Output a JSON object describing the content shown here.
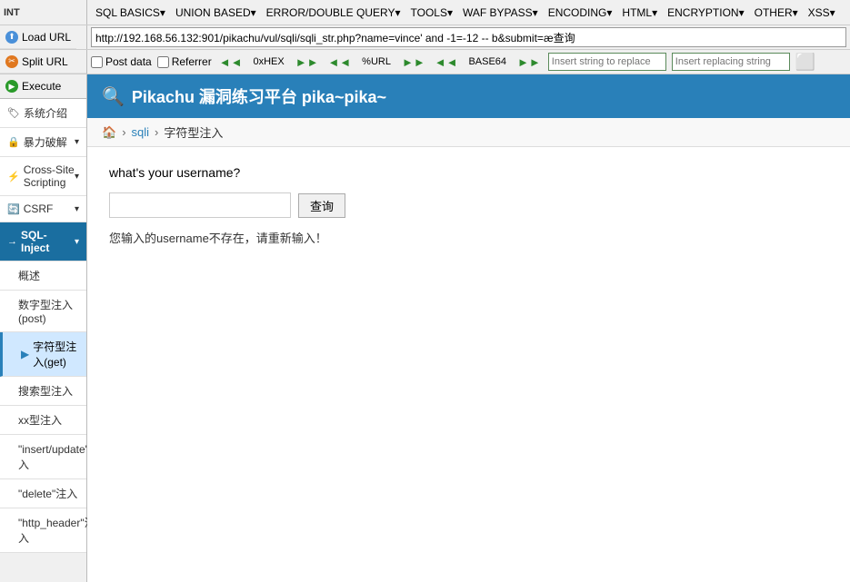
{
  "toolbar": {
    "int_label": "INT",
    "menu_items": [
      {
        "label": "SQL BASICS",
        "has_arrow": true
      },
      {
        "label": "UNION BASED",
        "has_arrow": true
      },
      {
        "label": "ERROR/DOUBLE QUERY",
        "has_arrow": true
      },
      {
        "label": "TOOLS",
        "has_arrow": true
      },
      {
        "label": "WAF BYPASS",
        "has_arrow": true
      },
      {
        "label": "ENCODING",
        "has_arrow": true
      },
      {
        "label": "HTML",
        "has_arrow": true
      },
      {
        "label": "ENCRYPTION",
        "has_arrow": true
      },
      {
        "label": "OTHER",
        "has_arrow": true
      },
      {
        "label": "XSS",
        "has_arrow": true
      }
    ],
    "load_url_label": "Load URL",
    "split_url_label": "Split URL",
    "execute_label": "Execute",
    "url_value": "http://192.168.56.132:901/pikachu/vul/sqli/sqli_str.php?name=vince' and -1=-12 -- b&submit=æ查询",
    "checkboxes": [
      {
        "label": "Post data",
        "checked": false
      },
      {
        "label": "Referrer",
        "checked": false
      }
    ],
    "encode_buttons": [
      {
        "label": "0xHEX"
      },
      {
        "label": "%URL"
      },
      {
        "label": "BASE64"
      }
    ],
    "string_to_replace_placeholder": "Insert string to replace",
    "replacing_string_placeholder": "Insert replacing string",
    "load_icon": "⬆",
    "split_icon": "✂",
    "execute_icon": "▶"
  },
  "app": {
    "header": {
      "icon": "🔍",
      "title": "Pikachu 漏洞练习平台 pika~pika~"
    },
    "breadcrumb": {
      "home_icon": "🏠",
      "links": [
        "sqli"
      ],
      "current": "字符型注入"
    }
  },
  "main": {
    "question": "what's your username?",
    "input_placeholder": "",
    "query_button_label": "查询",
    "result_text": "您输入的username不存在，请重新输入！"
  },
  "sidebar": {
    "items": [
      {
        "label": "系统介绍",
        "icon": "🏷",
        "level": "top",
        "has_chevron": false
      },
      {
        "label": "暴力破解",
        "icon": "🔒",
        "level": "top",
        "has_chevron": true
      },
      {
        "label": "Cross-Site Scripting",
        "icon": "⚡",
        "level": "top",
        "has_chevron": true
      },
      {
        "label": "CSRF",
        "icon": "🔄",
        "level": "top",
        "has_chevron": true
      },
      {
        "label": "SQL-Inject",
        "icon": "→",
        "level": "top-active",
        "has_chevron": true
      },
      {
        "label": "概述",
        "level": "sub"
      },
      {
        "label": "数字型注入(post)",
        "level": "sub"
      },
      {
        "label": "字符型注入(get)",
        "level": "sub-selected"
      },
      {
        "label": "搜索型注入",
        "level": "sub"
      },
      {
        "label": "xx型注入",
        "level": "sub"
      },
      {
        "label": "\"insert/update\"注入",
        "level": "sub"
      },
      {
        "label": "\"delete\"注入",
        "level": "sub"
      },
      {
        "label": "\"http_header\"注入",
        "level": "sub"
      }
    ]
  }
}
